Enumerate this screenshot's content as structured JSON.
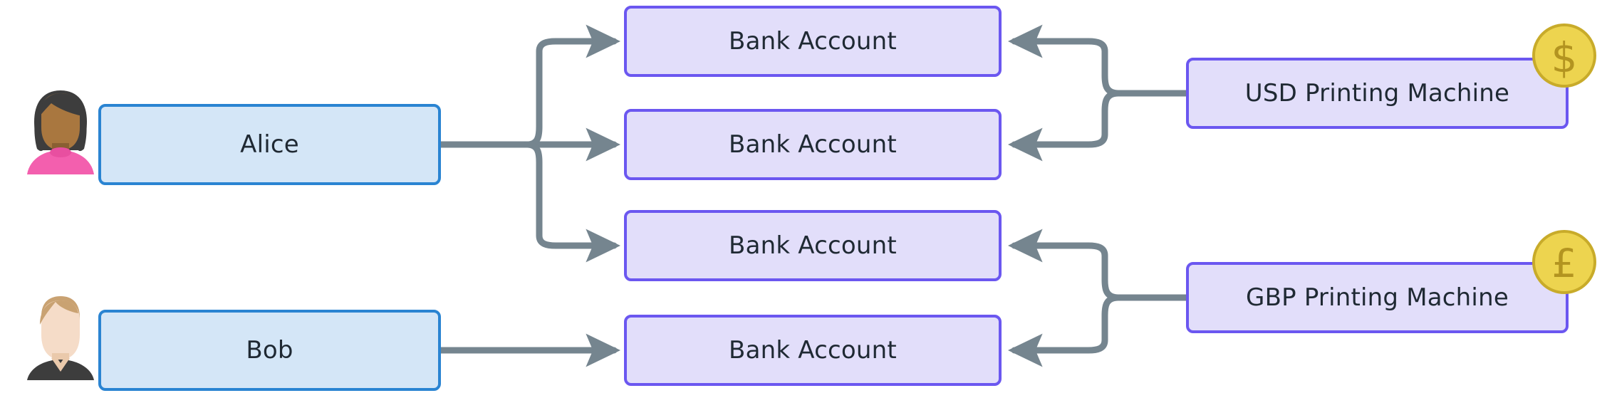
{
  "diagram": {
    "type": "flow-diagram",
    "title": "",
    "background_color": "#ffffff",
    "colors": {
      "person_fill": "#d4e6f7",
      "person_stroke": "#2a84d2",
      "account_fill": "#e2defa",
      "account_stroke": "#6b57f0",
      "machine_fill": "#e2defa",
      "machine_stroke": "#6b57f0",
      "edge": "#75858f",
      "coin_fill": "#edd44f",
      "coin_stroke": "#c8ab2a",
      "text": "#1f2933"
    },
    "people": [
      {
        "id": "alice",
        "label": "Alice",
        "avatar": "woman-avatar-icon"
      },
      {
        "id": "bob",
        "label": "Bob",
        "avatar": "man-avatar-icon"
      }
    ],
    "accounts": [
      {
        "id": "acct1",
        "label": "Bank Account"
      },
      {
        "id": "acct2",
        "label": "Bank Account"
      },
      {
        "id": "acct3",
        "label": "Bank Account"
      },
      {
        "id": "acct4",
        "label": "Bank Account"
      }
    ],
    "machines": [
      {
        "id": "usd",
        "label": "USD Printing Machine",
        "coin": "dollar-coin-icon",
        "coin_symbol": "$"
      },
      {
        "id": "gbp",
        "label": "GBP Printing Machine",
        "coin": "pound-coin-icon",
        "coin_symbol": "£"
      }
    ],
    "edges": [
      {
        "from": "alice",
        "to": "acct1"
      },
      {
        "from": "alice",
        "to": "acct2"
      },
      {
        "from": "alice",
        "to": "acct3"
      },
      {
        "from": "bob",
        "to": "acct4"
      },
      {
        "from": "usd",
        "to": "acct1"
      },
      {
        "from": "usd",
        "to": "acct2"
      },
      {
        "from": "gbp",
        "to": "acct3"
      },
      {
        "from": "gbp",
        "to": "acct4"
      }
    ]
  }
}
